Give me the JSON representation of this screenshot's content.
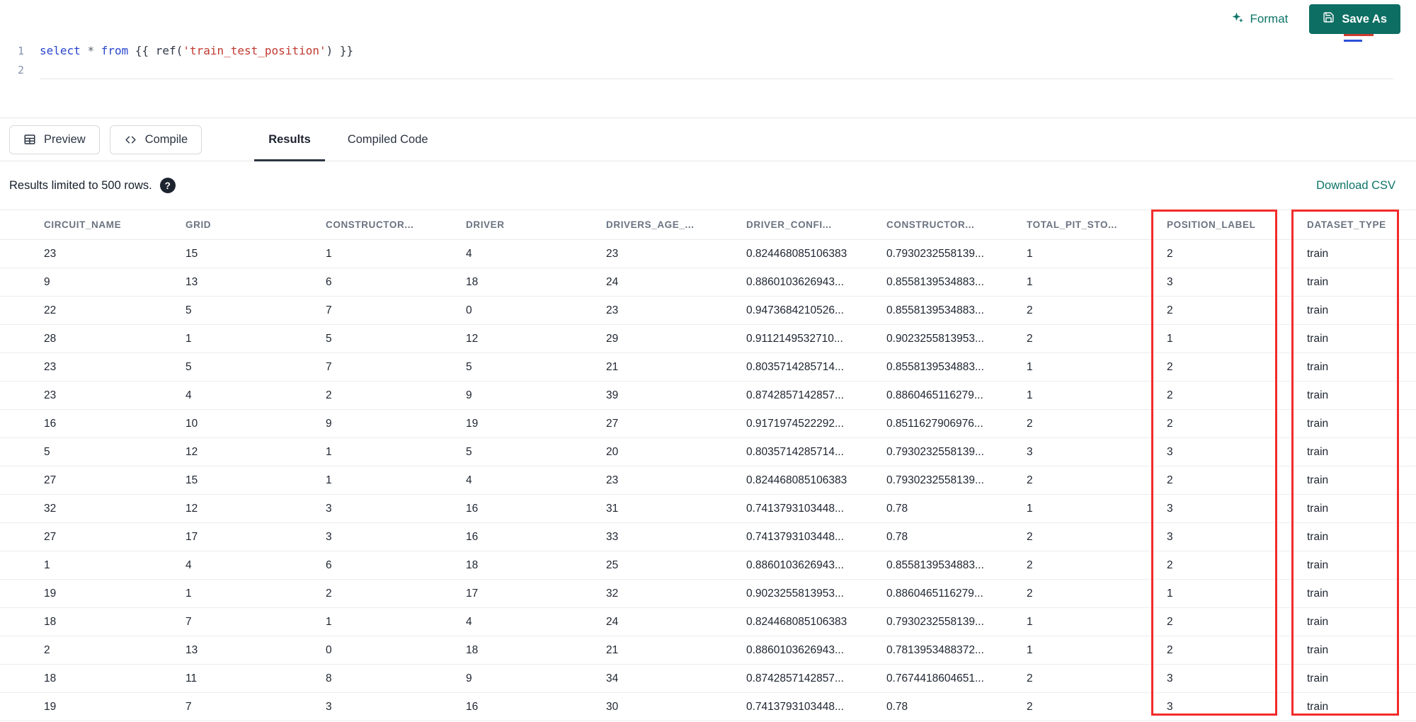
{
  "colors": {
    "accent": "#0d7468",
    "save_button_bg": "#0d6e63",
    "annotation_red": "#f22b2b"
  },
  "topbar": {
    "format_label": "Format",
    "save_as_label": "Save As"
  },
  "editor": {
    "lines": [
      {
        "number": "1",
        "tokens": [
          {
            "text": "select",
            "type": "keyword"
          },
          {
            "text": " ",
            "type": "plain"
          },
          {
            "text": "*",
            "type": "operator"
          },
          {
            "text": " ",
            "type": "plain"
          },
          {
            "text": "from",
            "type": "keyword"
          },
          {
            "text": " {{ ",
            "type": "plain"
          },
          {
            "text": "ref(",
            "type": "function"
          },
          {
            "text": "'train_test_position'",
            "type": "string"
          },
          {
            "text": ")",
            "type": "function"
          },
          {
            "text": " }}",
            "type": "plain"
          }
        ]
      },
      {
        "number": "2",
        "tokens": []
      }
    ]
  },
  "toolbar": {
    "preview_label": "Preview",
    "compile_label": "Compile",
    "tabs": [
      {
        "label": "Results",
        "active": true
      },
      {
        "label": "Compiled Code",
        "active": false
      }
    ]
  },
  "results": {
    "limit_note": "Results limited to 500 rows.",
    "help_glyph": "?",
    "download_label": "Download CSV",
    "columns": [
      "CIRCUIT_NAME",
      "GRID",
      "CONSTRUCTOR...",
      "DRIVER",
      "DRIVERS_AGE_...",
      "DRIVER_CONFI...",
      "CONSTRUCTOR...",
      "TOTAL_PIT_STO...",
      "POSITION_LABEL",
      "DATASET_TYPE"
    ],
    "highlighted_columns": [
      8,
      9
    ],
    "rows": [
      [
        "23",
        "15",
        "1",
        "4",
        "23",
        "0.824468085106383",
        "0.7930232558139...",
        "1",
        "2",
        "train"
      ],
      [
        "9",
        "13",
        "6",
        "18",
        "24",
        "0.8860103626943...",
        "0.8558139534883...",
        "1",
        "3",
        "train"
      ],
      [
        "22",
        "5",
        "7",
        "0",
        "23",
        "0.9473684210526...",
        "0.8558139534883...",
        "2",
        "2",
        "train"
      ],
      [
        "28",
        "1",
        "5",
        "12",
        "29",
        "0.9112149532710...",
        "0.9023255813953...",
        "2",
        "1",
        "train"
      ],
      [
        "23",
        "5",
        "7",
        "5",
        "21",
        "0.8035714285714...",
        "0.8558139534883...",
        "1",
        "2",
        "train"
      ],
      [
        "23",
        "4",
        "2",
        "9",
        "39",
        "0.8742857142857...",
        "0.8860465116279...",
        "1",
        "2",
        "train"
      ],
      [
        "16",
        "10",
        "9",
        "19",
        "27",
        "0.9171974522292...",
        "0.8511627906976...",
        "2",
        "2",
        "train"
      ],
      [
        "5",
        "12",
        "1",
        "5",
        "20",
        "0.8035714285714...",
        "0.7930232558139...",
        "3",
        "3",
        "train"
      ],
      [
        "27",
        "15",
        "1",
        "4",
        "23",
        "0.824468085106383",
        "0.7930232558139...",
        "2",
        "2",
        "train"
      ],
      [
        "32",
        "12",
        "3",
        "16",
        "31",
        "0.7413793103448...",
        "0.78",
        "1",
        "3",
        "train"
      ],
      [
        "27",
        "17",
        "3",
        "16",
        "33",
        "0.7413793103448...",
        "0.78",
        "2",
        "3",
        "train"
      ],
      [
        "1",
        "4",
        "6",
        "18",
        "25",
        "0.8860103626943...",
        "0.8558139534883...",
        "2",
        "2",
        "train"
      ],
      [
        "19",
        "1",
        "2",
        "17",
        "32",
        "0.9023255813953...",
        "0.8860465116279...",
        "2",
        "1",
        "train"
      ],
      [
        "18",
        "7",
        "1",
        "4",
        "24",
        "0.824468085106383",
        "0.7930232558139...",
        "1",
        "2",
        "train"
      ],
      [
        "2",
        "13",
        "0",
        "18",
        "21",
        "0.8860103626943...",
        "0.7813953488372...",
        "1",
        "2",
        "train"
      ],
      [
        "18",
        "11",
        "8",
        "9",
        "34",
        "0.8742857142857...",
        "0.7674418604651...",
        "2",
        "3",
        "train"
      ],
      [
        "19",
        "7",
        "3",
        "16",
        "30",
        "0.7413793103448...",
        "0.78",
        "2",
        "3",
        "train"
      ]
    ]
  }
}
